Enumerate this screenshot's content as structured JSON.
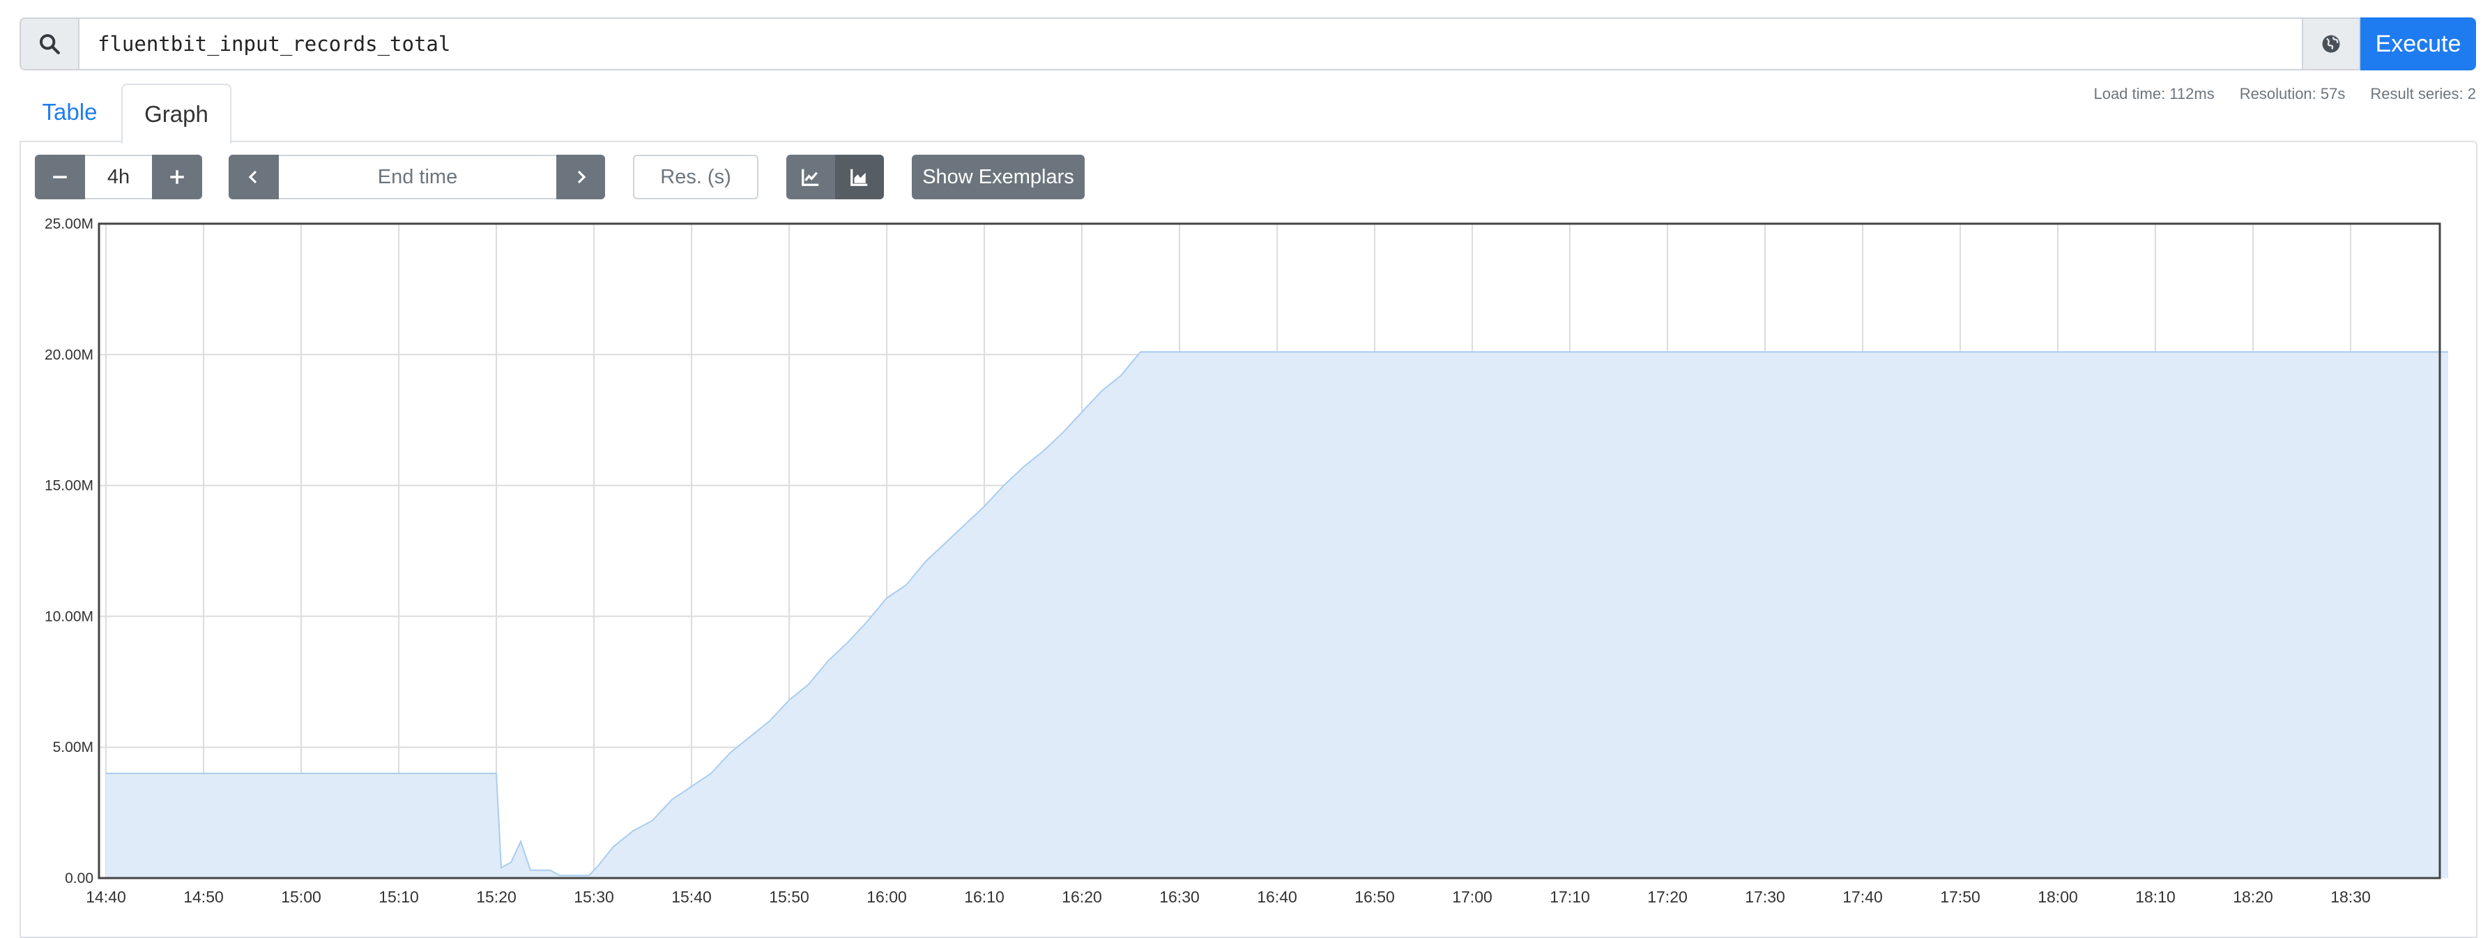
{
  "query": {
    "expression": "fluentbit_input_records_total",
    "search_icon": "search-icon",
    "globe_icon": "globe-icon",
    "execute_label": "Execute"
  },
  "tabs": [
    {
      "label": "Table",
      "active": false
    },
    {
      "label": "Graph",
      "active": true
    }
  ],
  "stats": {
    "load_time": "Load time: 112ms",
    "resolution": "Resolution: 57s",
    "result_series": "Result series: 2"
  },
  "controls": {
    "range": "4h",
    "end_time_placeholder": "End time",
    "resolution_placeholder": "Res. (s)",
    "show_exemplars": "Show Exemplars",
    "colors": {
      "accent": "#1f7cf0",
      "button": "#6c757d",
      "button_active": "#565e64"
    }
  },
  "chart_data": {
    "type": "area",
    "yticks": [
      "0.00",
      "5.00M",
      "10.00M",
      "15.00M",
      "20.00M",
      "25.00M"
    ],
    "ylim": [
      0,
      25000000
    ],
    "xticks": [
      "14:40",
      "14:50",
      "15:00",
      "15:10",
      "15:20",
      "15:30",
      "15:40",
      "15:50",
      "16:00",
      "16:10",
      "16:20",
      "16:30",
      "16:40",
      "16:50",
      "17:00",
      "17:10",
      "17:20",
      "17:30",
      "17:40",
      "17:50",
      "18:00",
      "18:10",
      "18:20",
      "18:30"
    ],
    "x_unit": "minutes since 14:40",
    "xlim": [
      0,
      240
    ],
    "grid": true,
    "fill_color": "#dfebf8",
    "line_color": "#a9cdf0",
    "series": [
      {
        "points": [
          [
            0,
            4.0
          ],
          [
            40,
            4.0
          ],
          [
            40.5,
            0.4
          ],
          [
            41.5,
            0.6
          ],
          [
            42.5,
            1.4
          ],
          [
            43.5,
            0.3
          ],
          [
            45.5,
            0.3
          ],
          [
            46.5,
            0.1
          ],
          [
            49.5,
            0.1
          ],
          [
            50.5,
            0.5
          ],
          [
            52,
            1.2
          ],
          [
            54,
            1.8
          ],
          [
            56,
            2.2
          ],
          [
            58,
            3.0
          ],
          [
            60,
            3.5
          ],
          [
            62,
            4.0
          ],
          [
            64,
            4.8
          ],
          [
            66,
            5.4
          ],
          [
            68,
            6.0
          ],
          [
            70,
            6.8
          ],
          [
            72,
            7.4
          ],
          [
            74,
            8.3
          ],
          [
            76,
            9.0
          ],
          [
            78,
            9.8
          ],
          [
            80,
            10.7
          ],
          [
            82,
            11.2
          ],
          [
            84,
            12.1
          ],
          [
            86,
            12.8
          ],
          [
            88,
            13.5
          ],
          [
            90,
            14.2
          ],
          [
            92,
            15.0
          ],
          [
            94,
            15.7
          ],
          [
            96,
            16.3
          ],
          [
            98,
            17.0
          ],
          [
            100,
            17.8
          ],
          [
            102,
            18.6
          ],
          [
            104,
            19.2
          ],
          [
            106,
            20.1
          ],
          [
            240,
            20.1
          ]
        ]
      }
    ]
  }
}
